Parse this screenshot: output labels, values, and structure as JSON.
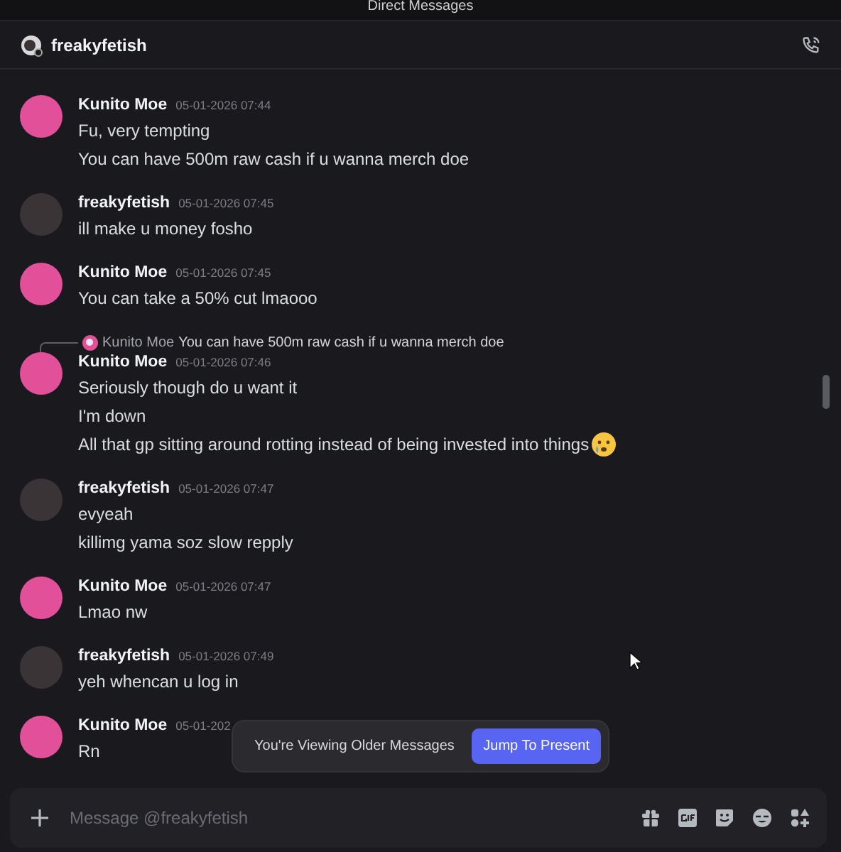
{
  "window": {
    "title": "Direct Messages"
  },
  "header": {
    "name": "freakyfetish"
  },
  "messages": [
    {
      "author": "Kunito Moe",
      "time": "05-01-2026 07:44",
      "avatar": {
        "color": "#e2509a"
      },
      "lines": [
        {
          "text": "Fu, very tempting"
        },
        {
          "text": "You can have 500m raw cash if u wanna merch doe"
        }
      ]
    },
    {
      "author": "freakyfetish",
      "time": "05-01-2026 07:45",
      "avatar": {
        "color": "#3a3436"
      },
      "lines": [
        {
          "text": "ill make u money fosho"
        }
      ]
    },
    {
      "author": "Kunito Moe",
      "time": "05-01-2026 07:45",
      "avatar": {
        "color": "#e2509a"
      },
      "lines": [
        {
          "text": "You can take a 50% cut lmaooo"
        }
      ]
    },
    {
      "author": "Kunito Moe",
      "time": "05-01-2026 07:46",
      "avatar": {
        "color": "#e2509a"
      },
      "reply": {
        "author": "Kunito Moe",
        "text": "You can have 500m raw cash if u wanna merch doe"
      },
      "lines": [
        {
          "text": "Seriously though do u want it"
        },
        {
          "text": "I'm down"
        },
        {
          "text": "All that gp sitting around rotting instead of being invested into things",
          "kind": "with_emoji"
        }
      ]
    },
    {
      "author": "freakyfetish",
      "time": "05-01-2026 07:47",
      "avatar": {
        "color": "#3a3436"
      },
      "lines": [
        {
          "text": "evyeah"
        },
        {
          "text": "killimg yama soz slow repply"
        }
      ]
    },
    {
      "author": "Kunito Moe",
      "time": "05-01-2026 07:47",
      "avatar": {
        "color": "#e2509a"
      },
      "lines": [
        {
          "text": "Lmao nw"
        }
      ]
    },
    {
      "author": "freakyfetish",
      "time": "05-01-2026 07:49",
      "avatar": {
        "color": "#3a3436"
      },
      "lines": [
        {
          "text": "yeh whencan u log in"
        }
      ]
    },
    {
      "author": "Kunito Moe",
      "time": "05-01-202",
      "avatar": {
        "color": "#e2509a"
      },
      "lines": [
        {
          "text": "Rn"
        }
      ]
    }
  ],
  "older_notice": {
    "text": "You're Viewing Older Messages",
    "button": "Jump To Present"
  },
  "composer": {
    "placeholder": "Message @freakyfetish"
  }
}
